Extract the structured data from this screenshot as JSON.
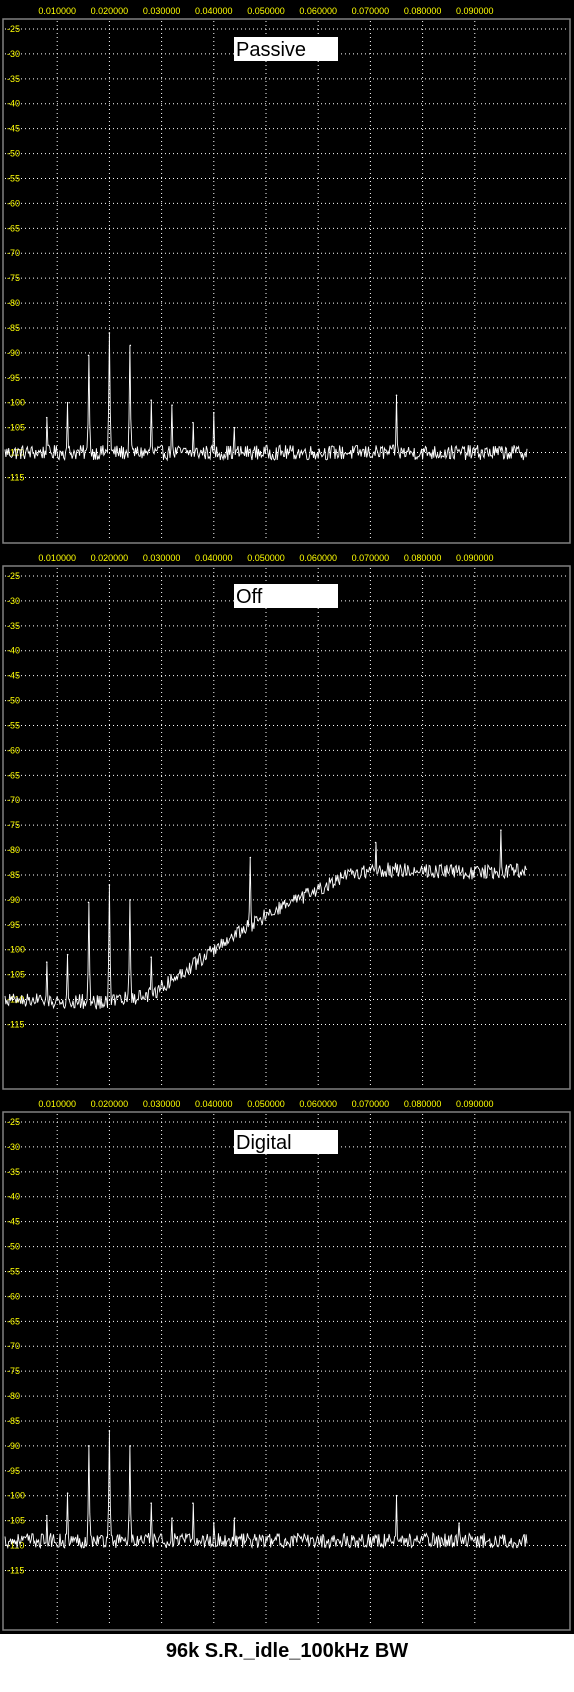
{
  "caption": "96k S.R._idle_100kHz BW",
  "colors": {
    "background": "#000000",
    "grid": "#ffffff",
    "tick_label": "#ffff00",
    "trace": "#ffffff",
    "frame": "#808080"
  },
  "chart_data": [
    {
      "type": "line",
      "label": "Passive",
      "x_tick_labels": [
        "0.010000",
        "0.020000",
        "0.030000",
        "0.040000",
        "0.050000",
        "0.060000",
        "0.070000",
        "0.080000",
        "0.090000"
      ],
      "y_tick_labels": [
        "-25",
        "-30",
        "-35",
        "-40",
        "-45",
        "-50",
        "-55",
        "-60",
        "-65",
        "-70",
        "-75",
        "-80",
        "-85",
        "-90",
        "-95",
        "-100",
        "-105",
        "-110",
        "-115"
      ],
      "xlim": [
        0,
        0.1
      ],
      "ylim": [
        -120,
        -20
      ],
      "grid": true,
      "noise_floor": [
        [
          0,
          -110
        ],
        [
          0.1,
          -110
        ]
      ],
      "peaks": [
        {
          "x": 0.008,
          "y": -103
        },
        {
          "x": 0.012,
          "y": -100
        },
        {
          "x": 0.016,
          "y": -90.5
        },
        {
          "x": 0.02,
          "y": -86
        },
        {
          "x": 0.024,
          "y": -88.5
        },
        {
          "x": 0.028,
          "y": -99.5
        },
        {
          "x": 0.032,
          "y": -100.5
        },
        {
          "x": 0.036,
          "y": -104
        },
        {
          "x": 0.04,
          "y": -102
        },
        {
          "x": 0.044,
          "y": -105
        },
        {
          "x": 0.075,
          "y": -98.5
        }
      ]
    },
    {
      "type": "line",
      "label": "Off",
      "x_tick_labels": [
        "0.010000",
        "0.020000",
        "0.030000",
        "0.040000",
        "0.050000",
        "0.060000",
        "0.070000",
        "0.080000",
        "0.090000"
      ],
      "y_tick_labels": [
        "-25",
        "-30",
        "-35",
        "-40",
        "-45",
        "-50",
        "-55",
        "-60",
        "-65",
        "-70",
        "-75",
        "-80",
        "-85",
        "-90",
        "-95",
        "-100",
        "-105",
        "-110",
        "-115"
      ],
      "xlim": [
        0,
        0.1
      ],
      "ylim": [
        -120,
        -20
      ],
      "grid": true,
      "noise_floor": [
        [
          0,
          -110
        ],
        [
          0.02,
          -110.5
        ],
        [
          0.028,
          -109
        ],
        [
          0.036,
          -103
        ],
        [
          0.044,
          -97
        ],
        [
          0.052,
          -92
        ],
        [
          0.06,
          -88
        ],
        [
          0.066,
          -85
        ],
        [
          0.07,
          -84
        ],
        [
          0.08,
          -84
        ],
        [
          0.09,
          -84.5
        ],
        [
          0.1,
          -84
        ]
      ],
      "peaks": [
        {
          "x": 0.008,
          "y": -102.5
        },
        {
          "x": 0.012,
          "y": -101
        },
        {
          "x": 0.016,
          "y": -90.5
        },
        {
          "x": 0.02,
          "y": -87
        },
        {
          "x": 0.024,
          "y": -90
        },
        {
          "x": 0.028,
          "y": -101.5
        },
        {
          "x": 0.047,
          "y": -81.5
        },
        {
          "x": 0.071,
          "y": -78.5
        },
        {
          "x": 0.095,
          "y": -76
        }
      ]
    },
    {
      "type": "line",
      "label": "Digital",
      "x_tick_labels": [
        "0.010000",
        "0.020000",
        "0.030000",
        "0.040000",
        "0.050000",
        "0.060000",
        "0.070000",
        "0.080000",
        "0.090000"
      ],
      "y_tick_labels": [
        "-25",
        "-30",
        "-35",
        "-40",
        "-45",
        "-50",
        "-55",
        "-60",
        "-65",
        "-70",
        "-75",
        "-80",
        "-85",
        "-90",
        "-95",
        "-100",
        "-105",
        "-110",
        "-115"
      ],
      "xlim": [
        0,
        0.1
      ],
      "ylim": [
        -120,
        -20
      ],
      "grid": true,
      "noise_floor": [
        [
          0,
          -109
        ],
        [
          0.1,
          -109
        ]
      ],
      "peaks": [
        {
          "x": 0.008,
          "y": -104
        },
        {
          "x": 0.012,
          "y": -99.5
        },
        {
          "x": 0.016,
          "y": -90
        },
        {
          "x": 0.02,
          "y": -87
        },
        {
          "x": 0.024,
          "y": -90
        },
        {
          "x": 0.028,
          "y": -101.5
        },
        {
          "x": 0.032,
          "y": -104.5
        },
        {
          "x": 0.036,
          "y": -101.5
        },
        {
          "x": 0.04,
          "y": -105.5
        },
        {
          "x": 0.044,
          "y": -104.5
        },
        {
          "x": 0.075,
          "y": -100
        },
        {
          "x": 0.087,
          "y": -105.5
        }
      ]
    }
  ]
}
